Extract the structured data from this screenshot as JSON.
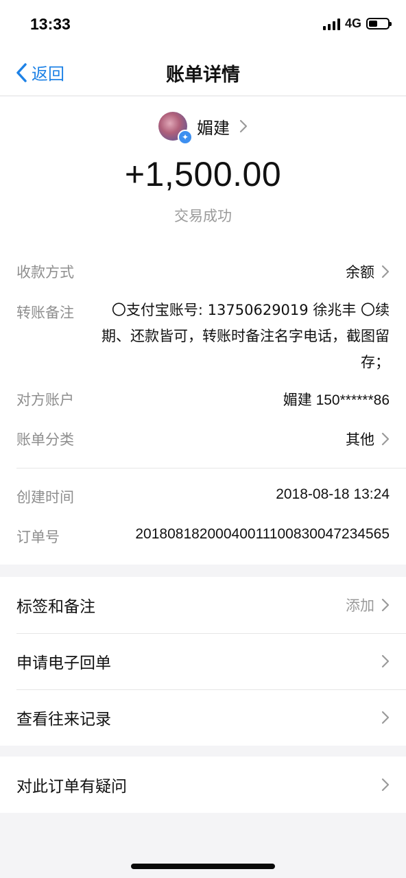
{
  "status_bar": {
    "time": "13:33",
    "network": "4G",
    "battery_level": 0.45
  },
  "nav": {
    "back_label": "返回",
    "title": "账单详情"
  },
  "payer": {
    "name": "媚建",
    "avatar_icon": "avatar-photo",
    "badge_icon": "star-badge-icon"
  },
  "transaction": {
    "amount": "+1,500.00",
    "status": "交易成功"
  },
  "details": {
    "payment_method": {
      "label": "收款方式",
      "value": "余额"
    },
    "remark": {
      "label": "转账备注",
      "value": "〇支付宝账号: 13750629019 徐兆丰 〇续期、还款皆可，转账时备注名字电话，截图留存；"
    },
    "counterparty": {
      "label": "对方账户",
      "value": "媚建 150******86"
    },
    "category": {
      "label": "账单分类",
      "value": "其他"
    },
    "created_time": {
      "label": "创建时间",
      "value": "2018-08-18 13:24"
    },
    "order_no": {
      "label": "订单号",
      "value": "20180818200040011100830047234565"
    }
  },
  "menu": {
    "tags": {
      "label": "标签和备注",
      "action": "添加"
    },
    "receipt": {
      "label": "申请电子回单"
    },
    "history": {
      "label": "查看往来记录"
    },
    "question": {
      "label": "对此订单有疑问"
    }
  },
  "colors": {
    "accent": "#1e82e6",
    "label_gray": "#8e8e8e",
    "background": "#f4f4f6"
  }
}
